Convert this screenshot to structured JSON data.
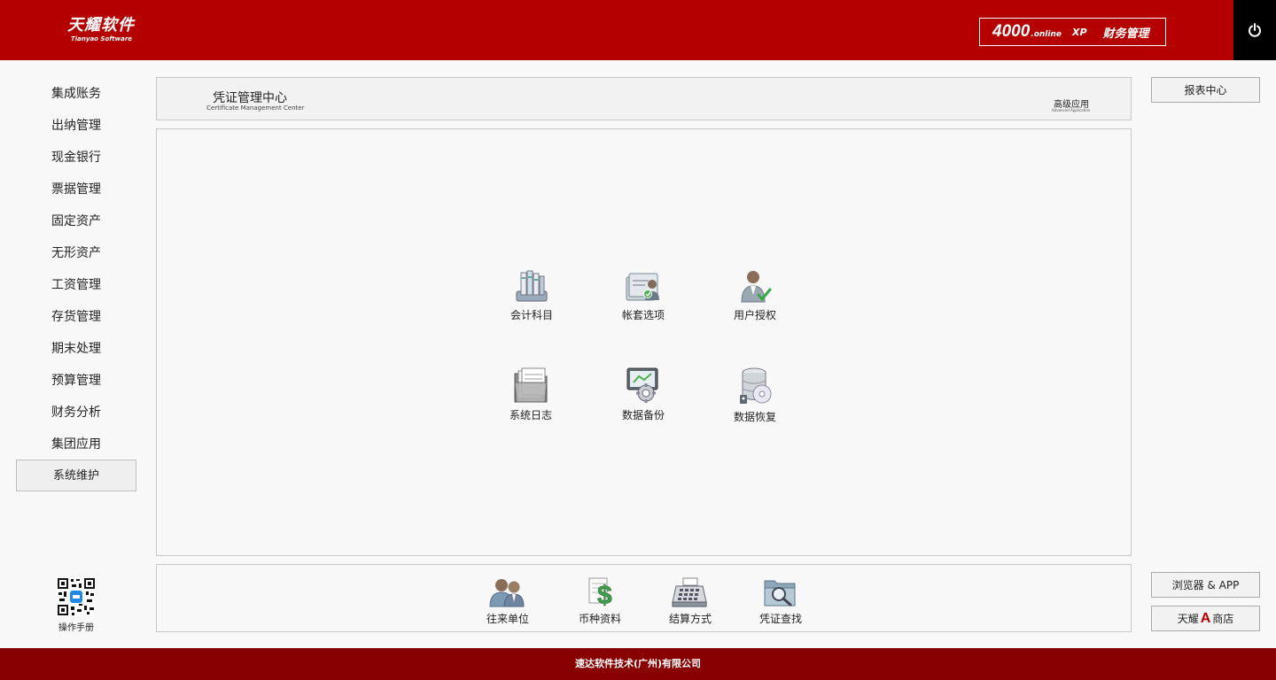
{
  "header": {
    "logo_main": "天耀软件",
    "logo_sub": "Tianyao Software",
    "badge_num": "4000",
    "badge_online": ".online",
    "badge_xp": "XP",
    "badge_name": "财务管理",
    "brand_color": "#b50000"
  },
  "sidebar": {
    "items": [
      {
        "label": "集成账务"
      },
      {
        "label": "出纳管理"
      },
      {
        "label": "现金银行"
      },
      {
        "label": "票据管理"
      },
      {
        "label": "固定资产"
      },
      {
        "label": "无形资产"
      },
      {
        "label": "工资管理"
      },
      {
        "label": "存货管理"
      },
      {
        "label": "期末处理"
      },
      {
        "label": "预算管理"
      },
      {
        "label": "财务分析"
      },
      {
        "label": "集团应用"
      },
      {
        "label": "系统维护",
        "active": true
      }
    ],
    "qr_label": "操作手册"
  },
  "title_panel": {
    "title": "凭证管理中心",
    "subtitle": "Certificate Management Center",
    "advanced": "高级应用",
    "advanced_sub": "Advanced Application"
  },
  "main_tiles": [
    {
      "label": "会计科目",
      "icon": "ledger-books-icon"
    },
    {
      "label": "帐套选项",
      "icon": "account-set-icon"
    },
    {
      "label": "用户授权",
      "icon": "user-authorize-icon"
    },
    {
      "label": "系统日志",
      "icon": "log-folder-icon"
    },
    {
      "label": "数据备份",
      "icon": "data-backup-icon"
    },
    {
      "label": "数据恢复",
      "icon": "data-restore-icon"
    }
  ],
  "bottom_tiles": [
    {
      "label": "往来单位",
      "icon": "contacts-icon"
    },
    {
      "label": "币种资料",
      "icon": "currency-icon"
    },
    {
      "label": "结算方式",
      "icon": "cash-register-icon"
    },
    {
      "label": "凭证查找",
      "icon": "folder-search-icon"
    }
  ],
  "right": {
    "report_center": "报表中心",
    "browser_app": "浏览器 & APP",
    "store_prefix": "天耀",
    "store_a": "A",
    "store_suffix": "商店"
  },
  "footer": {
    "text": "速达软件技术(广州)有限公司"
  }
}
